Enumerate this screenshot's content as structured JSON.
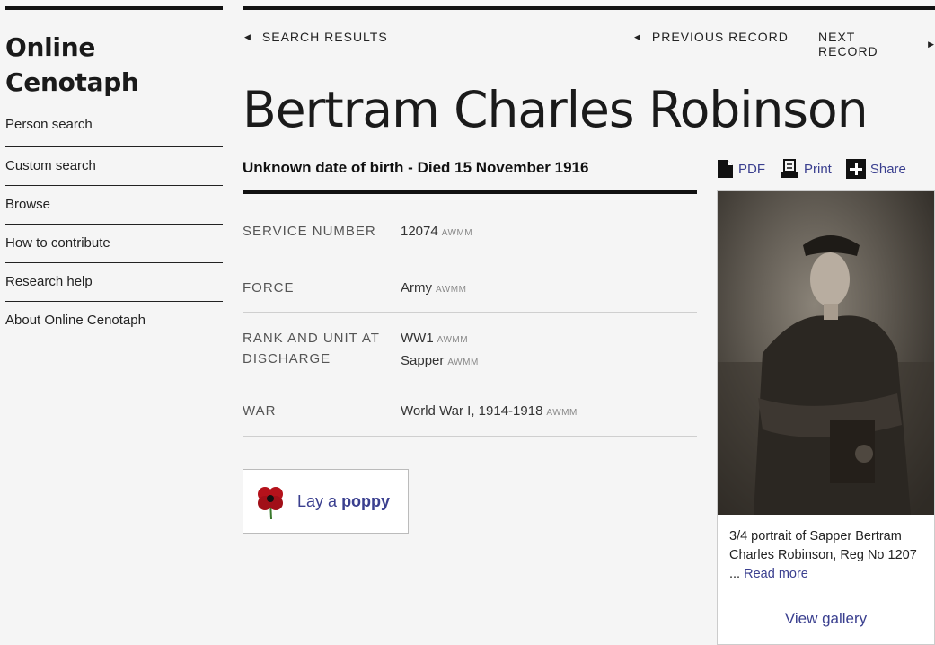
{
  "sidebar": {
    "title_line1": "Online",
    "title_line2": "Cenotaph",
    "items": [
      {
        "label": "Person search"
      },
      {
        "label": "Custom search"
      },
      {
        "label": "Browse"
      },
      {
        "label": "How to contribute"
      },
      {
        "label": "Research help"
      },
      {
        "label": "About Online Cenotaph"
      }
    ]
  },
  "toolbar": {
    "search_results": "SEARCH RESULTS",
    "previous_record": "PREVIOUS RECORD",
    "next_record": "NEXT RECORD"
  },
  "record": {
    "name": "Bertram Charles Robinson",
    "birth": "Unknown date of birth",
    "separator": "-",
    "death": "Died 15 November 1916",
    "source_tag": "AWMM",
    "fields": {
      "service_number": {
        "label": "SERVICE NUMBER",
        "value": "12074"
      },
      "force": {
        "label": "FORCE",
        "value": "Army"
      },
      "rank_unit": {
        "label_line1": "RANK AND UNIT AT",
        "label_line2": "DISCHARGE",
        "value1": "WW1",
        "value2": "Sapper"
      },
      "war": {
        "label": "WAR",
        "value": "World War I, 1914-1918"
      }
    }
  },
  "poppy": {
    "prefix": "Lay a",
    "bold": "poppy",
    "color": "#b5121b"
  },
  "actions": {
    "pdf": "PDF",
    "print": "Print",
    "share": "Share"
  },
  "photo": {
    "caption": "3/4 portrait of Sapper Bertram Charles Robinson, Reg No 1207 ...",
    "read_more": "Read more",
    "view_gallery": "View gallery"
  },
  "colors": {
    "link": "#3a3f8f",
    "rule": "#111111"
  }
}
